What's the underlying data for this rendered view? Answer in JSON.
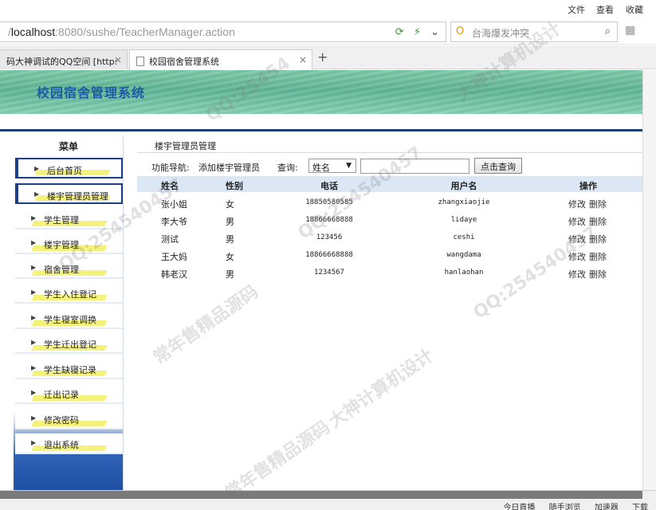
{
  "browser": {
    "menu": [
      "文件",
      "查看",
      "收藏"
    ],
    "url_host": "localhost",
    "url_rest": ":8080/sushe/TeacherManager.action",
    "url_prefix": "/",
    "search_placeholder": "台海爆发冲突",
    "tabs": [
      {
        "label": "码大神调试的QQ空间 [http:"
      },
      {
        "label": "校园宿舍管理系统"
      }
    ],
    "status_items": [
      "今日直播",
      "随手浏览",
      "加速器",
      "下载"
    ]
  },
  "banner": {
    "title": "校园宿舍管理系统"
  },
  "sidebar": {
    "heading": "菜单",
    "items": [
      {
        "label": "后台首页"
      },
      {
        "label": "楼宇管理员管理"
      },
      {
        "label": "学生管理"
      },
      {
        "label": "楼宇管理"
      },
      {
        "label": "宿舍管理"
      },
      {
        "label": "学生入住登记"
      },
      {
        "label": "学生寝室调换"
      },
      {
        "label": "学生迁出登记"
      },
      {
        "label": "学生缺寝记录"
      },
      {
        "label": "迁出记录"
      },
      {
        "label": "修改密码"
      },
      {
        "label": "退出系统"
      }
    ]
  },
  "main": {
    "title": "楼宇管理员管理",
    "nav_label": "功能导航:",
    "add_link": "添加楼宇管理员",
    "query_label": "查询:",
    "query_field": "姓名",
    "query_value": "",
    "query_button": "点击查询",
    "columns": [
      "姓名",
      "性别",
      "电话",
      "用户名",
      "操作"
    ],
    "rows": [
      {
        "name": "张小姐",
        "sex": "女",
        "phone": "18850580585",
        "user": "zhangxiaojie",
        "edit": "修改",
        "del": "删除"
      },
      {
        "name": "李大爷",
        "sex": "男",
        "phone": "18866668888",
        "user": "lidaye",
        "edit": "修改",
        "del": "删除"
      },
      {
        "name": "测试",
        "sex": "男",
        "phone": "123456",
        "user": "ceshi",
        "edit": "修改",
        "del": "删除"
      },
      {
        "name": "王大妈",
        "sex": "女",
        "phone": "18866668888",
        "user": "wangdama",
        "edit": "修改",
        "del": "删除"
      },
      {
        "name": "韩老汉",
        "sex": "男",
        "phone": "1234567",
        "user": "hanlaohan",
        "edit": "修改",
        "del": "删除"
      }
    ]
  },
  "watermarks": [
    "QQ:25454",
    "大神计算机设计",
    "QQ:254540457",
    "常年售精品源码",
    "QQ:254540457",
    "大神计算机设计",
    "QQ:254540457",
    "常年售精品源码"
  ]
}
